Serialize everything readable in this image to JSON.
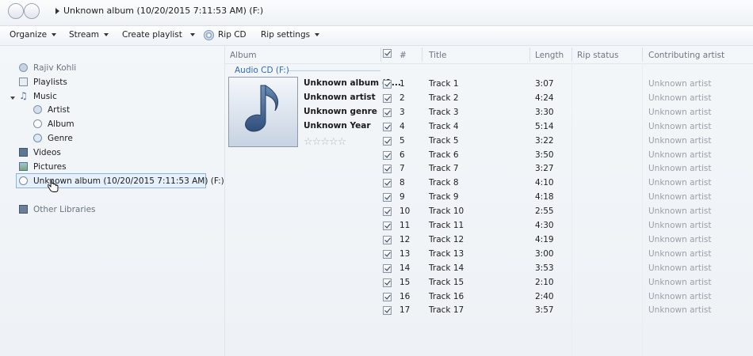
{
  "titlebar": {
    "breadcrumb": "Unknown album (10/20/2015 7:11:53 AM) (F:)"
  },
  "toolbar": {
    "organize": "Organize",
    "stream": "Stream",
    "create_playlist": "Create playlist",
    "rip_cd": "Rip CD",
    "rip_settings": "Rip settings"
  },
  "nav": {
    "user": "Rajiv Kohli",
    "playlists": "Playlists",
    "music": "Music",
    "artist": "Artist",
    "album": "Album",
    "genre": "Genre",
    "videos": "Videos",
    "pictures": "Pictures",
    "disc": "Unknown album (10/20/2015 7:11:53 AM) (F:)",
    "other_libraries": "Other Libraries"
  },
  "columns": {
    "album": "Album",
    "number": "#",
    "title": "Title",
    "length": "Length",
    "rip_status": "Rip status",
    "contributing_artist": "Contributing artist"
  },
  "group_title": "Audio CD (F:)",
  "album_info": {
    "album": "Unknown album (1...",
    "artist": "Unknown artist",
    "genre": "Unknown genre",
    "year": "Unknown Year",
    "stars": "☆☆☆☆☆",
    "rating": 0
  },
  "colors": {
    "accent": "#2f69b8",
    "selection": "#e5f0fb",
    "muted": "#9aa1a9"
  },
  "tracks": [
    {
      "num": "1",
      "title": "Track 1",
      "length": "3:07",
      "artist": "Unknown artist",
      "checked": true
    },
    {
      "num": "2",
      "title": "Track 2",
      "length": "4:24",
      "artist": "Unknown artist",
      "checked": true
    },
    {
      "num": "3",
      "title": "Track 3",
      "length": "3:30",
      "artist": "Unknown artist",
      "checked": true
    },
    {
      "num": "4",
      "title": "Track 4",
      "length": "5:14",
      "artist": "Unknown artist",
      "checked": true
    },
    {
      "num": "5",
      "title": "Track 5",
      "length": "3:22",
      "artist": "Unknown artist",
      "checked": true
    },
    {
      "num": "6",
      "title": "Track 6",
      "length": "3:50",
      "artist": "Unknown artist",
      "checked": true
    },
    {
      "num": "7",
      "title": "Track 7",
      "length": "3:27",
      "artist": "Unknown artist",
      "checked": true
    },
    {
      "num": "8",
      "title": "Track 8",
      "length": "4:10",
      "artist": "Unknown artist",
      "checked": true
    },
    {
      "num": "9",
      "title": "Track 9",
      "length": "4:18",
      "artist": "Unknown artist",
      "checked": true
    },
    {
      "num": "10",
      "title": "Track 10",
      "length": "2:55",
      "artist": "Unknown artist",
      "checked": true
    },
    {
      "num": "11",
      "title": "Track 11",
      "length": "4:30",
      "artist": "Unknown artist",
      "checked": true
    },
    {
      "num": "12",
      "title": "Track 12",
      "length": "4:19",
      "artist": "Unknown artist",
      "checked": true
    },
    {
      "num": "13",
      "title": "Track 13",
      "length": "3:00",
      "artist": "Unknown artist",
      "checked": true
    },
    {
      "num": "14",
      "title": "Track 14",
      "length": "3:53",
      "artist": "Unknown artist",
      "checked": true
    },
    {
      "num": "15",
      "title": "Track 15",
      "length": "2:10",
      "artist": "Unknown artist",
      "checked": true
    },
    {
      "num": "16",
      "title": "Track 16",
      "length": "2:40",
      "artist": "Unknown artist",
      "checked": true
    },
    {
      "num": "17",
      "title": "Track 17",
      "length": "3:57",
      "artist": "Unknown artist",
      "checked": true
    }
  ]
}
